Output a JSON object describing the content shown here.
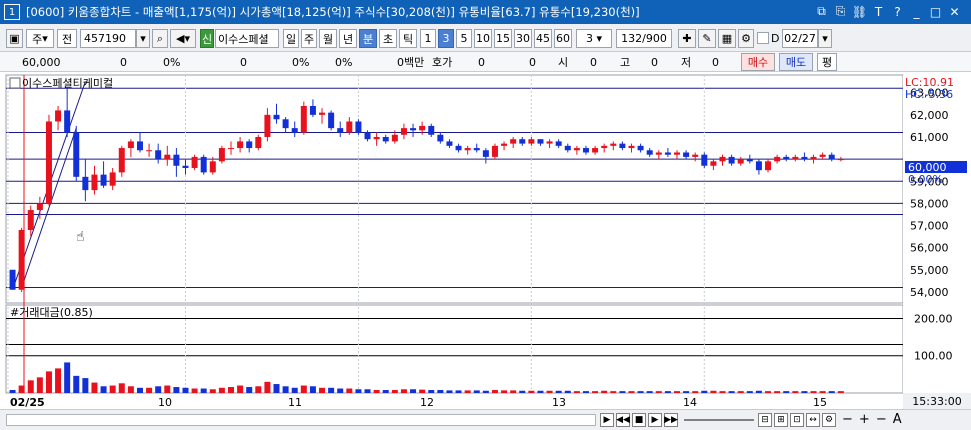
{
  "titlebar": {
    "window_no": "1",
    "title": "[0600] 키움종합차트 - 매출액[1,175(억)] 시가총액[18,125(억)] 주식수[30,208(천)] 유통비율[63.7] 유통수[19,230(천)]",
    "icons": [
      "restore-icon",
      "pin-icon",
      "link-icon",
      "font-icon",
      "help-icon",
      "minimize-icon",
      "maximize-icon",
      "close-icon"
    ]
  },
  "toolbar": {
    "market": "주",
    "prefix": "전",
    "code": "457190",
    "credit_badge": "신",
    "stock_name": "이수스페셜",
    "periods": [
      "일",
      "주",
      "월",
      "년",
      "분",
      "초",
      "틱"
    ],
    "active_period": "분",
    "intervals": [
      "1",
      "3",
      "5",
      "10",
      "15",
      "30",
      "45",
      "60"
    ],
    "active_interval": "3",
    "interval_select": "3",
    "count": "132",
    "count_total": "/900",
    "d_label": "D",
    "date": "02/27"
  },
  "inforow": {
    "v1": "60,000",
    "v2": "0",
    "v3": "0%",
    "v4": "0",
    "v5": "0%",
    "v6": "0%",
    "v7": "0백만",
    "label_hoga": "호가",
    "v8": "0",
    "v9": "0",
    "label_si": "시",
    "v10": "0",
    "label_go": "고",
    "v11": "0",
    "label_jeo": "저",
    "v12": "0",
    "buy": "매수",
    "sell": "매도",
    "avg": "평"
  },
  "chart": {
    "price_title": "이수스페셜티케미컬",
    "lc": "LC:10.91",
    "hc": "HC:-5.36",
    "price_ticks": [
      "63,000",
      "62,000",
      "61,000",
      "60,000",
      "59,000",
      "58,000",
      "57,000",
      "56,000",
      "55,000",
      "54,000"
    ],
    "current_price": "60,000",
    "current_pct": "0.00%",
    "volume_title": "#거래대금(0.85)",
    "volume_ticks": [
      "200.00",
      "100.00"
    ],
    "x_labels": [
      "02/25",
      "10",
      "11",
      "12",
      "13",
      "14",
      "15"
    ],
    "clock": "15:33:00"
  },
  "colors": {
    "up": "#e8121e",
    "down": "#1230d8",
    "titlebar": "#0f62b8",
    "grid": "#1a1a8a"
  },
  "chart_data": {
    "type": "candlestick",
    "title": "이수스페셜티케미컬",
    "ylim": [
      53500,
      63800
    ],
    "candles_ohlc": [
      [
        55000,
        55000,
        54200,
        54100
      ],
      [
        54100,
        56900,
        54000,
        56800
      ],
      [
        56800,
        57900,
        56500,
        57700
      ],
      [
        57700,
        58300,
        57300,
        58000
      ],
      [
        58000,
        62000,
        57900,
        61700
      ],
      [
        61700,
        62400,
        61300,
        62200
      ],
      [
        62200,
        63200,
        61000,
        61200
      ],
      [
        61200,
        61500,
        59000,
        59200
      ],
      [
        59200,
        60000,
        58100,
        58600
      ],
      [
        58600,
        59700,
        58400,
        59300
      ],
      [
        59300,
        59900,
        58700,
        58800
      ],
      [
        58800,
        59600,
        58600,
        59400
      ],
      [
        59400,
        60600,
        59200,
        60500
      ],
      [
        60500,
        60900,
        60100,
        60800
      ],
      [
        60800,
        61200,
        60300,
        60400
      ],
      [
        60400,
        60700,
        60100,
        60400
      ],
      [
        60400,
        60700,
        59800,
        60000
      ],
      [
        60000,
        60600,
        59700,
        60200
      ],
      [
        60200,
        60500,
        59200,
        59700
      ],
      [
        59700,
        60000,
        59300,
        59600
      ],
      [
        59600,
        60200,
        59500,
        60100
      ],
      [
        60100,
        60200,
        59300,
        59400
      ],
      [
        59400,
        60100,
        59300,
        59900
      ],
      [
        59900,
        60600,
        59800,
        60500
      ],
      [
        60500,
        60800,
        60200,
        60500
      ],
      [
        60500,
        61000,
        60300,
        60800
      ],
      [
        60800,
        60900,
        60300,
        60500
      ],
      [
        60500,
        61100,
        60400,
        61000
      ],
      [
        61000,
        62300,
        60800,
        62000
      ],
      [
        62000,
        62500,
        61600,
        61800
      ],
      [
        61800,
        61900,
        61200,
        61400
      ],
      [
        61400,
        61700,
        61000,
        61200
      ],
      [
        61200,
        62600,
        61100,
        62400
      ],
      [
        62400,
        62700,
        61900,
        62000
      ],
      [
        62000,
        62300,
        61600,
        62100
      ],
      [
        62100,
        62200,
        61300,
        61400
      ],
      [
        61400,
        61700,
        61000,
        61200
      ],
      [
        61200,
        61900,
        61100,
        61700
      ],
      [
        61700,
        61800,
        61100,
        61200
      ],
      [
        61200,
        61300,
        60800,
        60900
      ],
      [
        60900,
        61200,
        60600,
        61000
      ],
      [
        61000,
        61100,
        60700,
        60800
      ],
      [
        60800,
        61300,
        60700,
        61100
      ],
      [
        61100,
        61600,
        60900,
        61400
      ],
      [
        61400,
        61600,
        61000,
        61300
      ],
      [
        61300,
        61700,
        61100,
        61500
      ],
      [
        61500,
        61600,
        61000,
        61100
      ],
      [
        61100,
        61200,
        60700,
        60800
      ],
      [
        60800,
        60900,
        60500,
        60600
      ],
      [
        60600,
        60700,
        60300,
        60400
      ],
      [
        60400,
        60600,
        60200,
        60500
      ],
      [
        60500,
        60700,
        60300,
        60400
      ],
      [
        60400,
        60500,
        59800,
        60100
      ],
      [
        60100,
        60700,
        60000,
        60600
      ],
      [
        60600,
        60800,
        60400,
        60700
      ],
      [
        60700,
        61000,
        60500,
        60900
      ],
      [
        60900,
        61000,
        60600,
        60700
      ],
      [
        60700,
        61000,
        60600,
        60900
      ],
      [
        60900,
        60900,
        60600,
        60700
      ],
      [
        60700,
        60900,
        60500,
        60800
      ],
      [
        60800,
        60900,
        60500,
        60600
      ],
      [
        60600,
        60700,
        60300,
        60400
      ],
      [
        60400,
        60600,
        60200,
        60500
      ],
      [
        60500,
        60600,
        60200,
        60300
      ],
      [
        60300,
        60600,
        60200,
        60500
      ],
      [
        60500,
        60700,
        60300,
        60600
      ],
      [
        60600,
        60800,
        60400,
        60700
      ],
      [
        60700,
        60800,
        60400,
        60500
      ],
      [
        60500,
        60700,
        60300,
        60600
      ],
      [
        60600,
        60700,
        60300,
        60400
      ],
      [
        60400,
        60500,
        60100,
        60200
      ],
      [
        60200,
        60400,
        60000,
        60300
      ],
      [
        60300,
        60500,
        60100,
        60200
      ],
      [
        60200,
        60400,
        60000,
        60300
      ],
      [
        60300,
        60400,
        60000,
        60100
      ],
      [
        60100,
        60300,
        59900,
        60200
      ],
      [
        60200,
        60300,
        59600,
        59700
      ],
      [
        59700,
        60000,
        59500,
        59900
      ],
      [
        59900,
        60200,
        59700,
        60100
      ],
      [
        60100,
        60200,
        59700,
        59800
      ],
      [
        59800,
        60100,
        59700,
        60000
      ],
      [
        60000,
        60200,
        59800,
        59900
      ],
      [
        59900,
        60000,
        59300,
        59500
      ],
      [
        59500,
        60000,
        59400,
        59900
      ],
      [
        59900,
        60200,
        59800,
        60100
      ],
      [
        60100,
        60200,
        59900,
        60000
      ],
      [
        60000,
        60200,
        59900,
        60100
      ],
      [
        60100,
        60300,
        59900,
        60000
      ],
      [
        60000,
        60200,
        59800,
        60100
      ],
      [
        60100,
        60300,
        60000,
        60200
      ],
      [
        60200,
        60300,
        59900,
        60000
      ],
      [
        60000,
        60100,
        59900,
        60000
      ]
    ],
    "volume": [
      8,
      20,
      34,
      42,
      58,
      66,
      82,
      46,
      40,
      28,
      18,
      20,
      26,
      18,
      14,
      14,
      18,
      20,
      16,
      14,
      12,
      12,
      10,
      14,
      16,
      20,
      16,
      18,
      30,
      24,
      18,
      14,
      20,
      18,
      14,
      14,
      12,
      12,
      10,
      10,
      8,
      8,
      8,
      10,
      10,
      9,
      8,
      8,
      7,
      7,
      7,
      7,
      6,
      8,
      7,
      7,
      6,
      6,
      6,
      6,
      6,
      6,
      5,
      5,
      5,
      6,
      5,
      5,
      5,
      5,
      5,
      5,
      5,
      5,
      5,
      5,
      6,
      6,
      5,
      5,
      5,
      5,
      6,
      5,
      5,
      5,
      5,
      5,
      5,
      5,
      5,
      5
    ],
    "volume_ylim": [
      0,
      220
    ],
    "horizontal_lines": [
      63200,
      61200,
      60000,
      59000,
      58000,
      57500,
      54200
    ],
    "trendlines": [
      [
        0,
        54100,
        8,
        63500
      ],
      [
        1,
        54200,
        7,
        61400
      ]
    ]
  }
}
